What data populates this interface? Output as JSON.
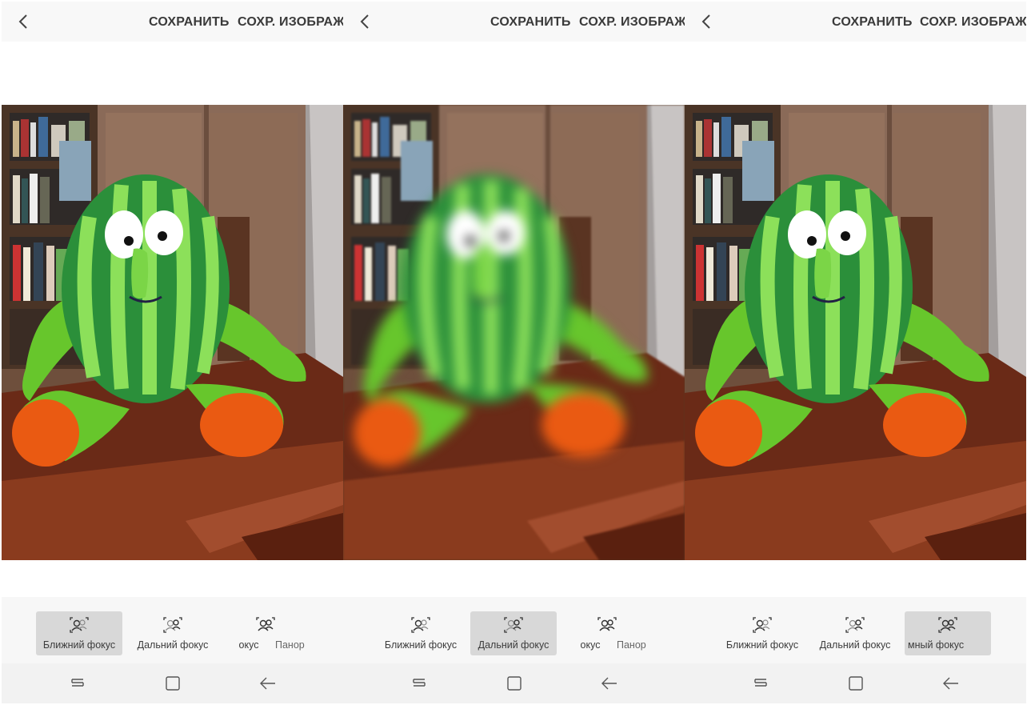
{
  "panels": [
    {
      "top_bar": {
        "save_label": "СОХРАНИТЬ",
        "save_image_label": "СОХР. ИЗОБРАЖ."
      },
      "photo_focus": "near",
      "modes": [
        {
          "label": "Ближний фокус",
          "selected": true
        },
        {
          "label": "Дальний фокус",
          "selected": false
        },
        {
          "label": "окус",
          "selected": false
        },
        {
          "label": "Панор",
          "selected": false
        }
      ]
    },
    {
      "top_bar": {
        "save_label": "СОХРАНИТЬ",
        "save_image_label": "СОХР. ИЗОБРАЖ."
      },
      "photo_focus": "far",
      "modes": [
        {
          "label": "Ближний фокус",
          "selected": false
        },
        {
          "label": "Дальний фокус",
          "selected": true
        },
        {
          "label": "окус",
          "selected": false
        },
        {
          "label": "Панор",
          "selected": false
        }
      ]
    },
    {
      "top_bar": {
        "save_label": "СОХРАНИТЬ",
        "save_image_label": "СОХР. ИЗОБРАЖ."
      },
      "photo_focus": "pan",
      "modes": [
        {
          "label": "Ближний фокус",
          "selected": false
        },
        {
          "label": "Дальний фокус",
          "selected": false
        },
        {
          "label": "мный фокус",
          "selected": true
        }
      ]
    }
  ],
  "icons": {
    "back": "chevron-left-icon",
    "mode": "focus-people-icon",
    "nav_recent": "recent-apps-icon",
    "nav_home": "home-icon",
    "nav_back": "back-arrow-icon"
  },
  "colors": {
    "bar_background": "#f8f8f8",
    "selected_mode": "#d8d8d8",
    "text": "#3a3a3a"
  }
}
